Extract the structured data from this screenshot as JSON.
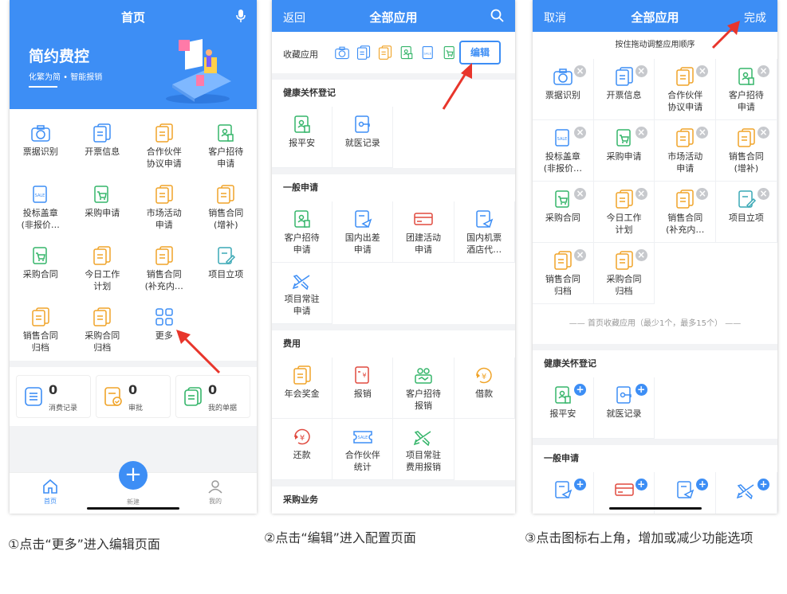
{
  "screen1": {
    "title": "首页",
    "banner_title": "简约费控",
    "banner_subtitle": "化繁为简 • 智能报销",
    "apps": [
      {
        "label": "票据识别",
        "icon": "camera-icon",
        "color": "#3d8ef5"
      },
      {
        "label": "开票信息",
        "icon": "docs-icon",
        "color": "#3d8ef5"
      },
      {
        "label": "合作伙伴\n协议申请",
        "icon": "docs-icon",
        "color": "#f0a429"
      },
      {
        "label": "客户招待\n申请",
        "icon": "user-doc-icon",
        "color": "#35b56a"
      },
      {
        "label": "投标盖章\n(非报价…",
        "icon": "sale-doc-icon",
        "color": "#3d8ef5"
      },
      {
        "label": "采购申请",
        "icon": "cart-doc-icon",
        "color": "#35b56a"
      },
      {
        "label": "市场活动\n申请",
        "icon": "docs-icon",
        "color": "#f0a429"
      },
      {
        "label": "销售合同\n(增补)",
        "icon": "docs-icon",
        "color": "#f0a429"
      },
      {
        "label": "采购合同",
        "icon": "cart-doc-icon",
        "color": "#35b56a"
      },
      {
        "label": "今日工作\n计划",
        "icon": "docs-icon",
        "color": "#f0a429"
      },
      {
        "label": "销售合同\n(补充内…",
        "icon": "docs-icon",
        "color": "#f0a429"
      },
      {
        "label": "项目立项",
        "icon": "edit-doc-icon",
        "color": "#3aa8b5"
      },
      {
        "label": "销售合同\n归档",
        "icon": "docs-icon",
        "color": "#f0a429"
      },
      {
        "label": "采购合同\n归档",
        "icon": "docs-icon",
        "color": "#f0a429"
      },
      {
        "label": "更多",
        "icon": "more-grid-icon",
        "color": "#3d8ef5"
      }
    ],
    "stats": [
      {
        "value": "0",
        "label": "消费记录",
        "icon": "list-icon",
        "color": "#3d8ef5"
      },
      {
        "value": "0",
        "label": "审批",
        "icon": "approve-icon",
        "color": "#f0a429"
      },
      {
        "value": "0",
        "label": "我的单据",
        "icon": "docs-icon",
        "color": "#35b56a"
      }
    ],
    "tabs": {
      "home": "首页",
      "new": "新建",
      "mine": "我的"
    }
  },
  "screen2": {
    "back": "返回",
    "title": "全部应用",
    "favorites_label": "收藏应用",
    "edit": "编辑",
    "sections": [
      {
        "title": "健康关怀登记",
        "apps": [
          {
            "label": "报平安",
            "icon": "user-doc-icon",
            "color": "#35b56a"
          },
          {
            "label": "就医记录",
            "icon": "key-doc-icon",
            "color": "#3d8ef5"
          }
        ]
      },
      {
        "title": "一般申请",
        "apps": [
          {
            "label": "客户招待\n申请",
            "icon": "user-doc-icon",
            "color": "#35b56a"
          },
          {
            "label": "国内出差\n申请",
            "icon": "plane-doc-icon",
            "color": "#3d8ef5"
          },
          {
            "label": "团建活动\n申请",
            "icon": "card-icon",
            "color": "#e04a3f"
          },
          {
            "label": "国内机票\n酒店代…",
            "icon": "plane-doc-icon",
            "color": "#3d8ef5"
          },
          {
            "label": "项目常驻\n申请",
            "icon": "plane-icon",
            "color": "#3d8ef5"
          }
        ]
      },
      {
        "title": "费用",
        "apps": [
          {
            "label": "年会奖金",
            "icon": "docs-icon",
            "color": "#f0a429"
          },
          {
            "label": "报销",
            "icon": "money-doc-icon",
            "color": "#e04a3f"
          },
          {
            "label": "客户招待\n报销",
            "icon": "people-icon",
            "color": "#35b56a"
          },
          {
            "label": "借款",
            "icon": "yen-icon",
            "color": "#f0a429"
          },
          {
            "label": "还款",
            "icon": "yen-icon",
            "color": "#e04a3f"
          },
          {
            "label": "合作伙伴\n统计",
            "icon": "ticket-icon",
            "color": "#3d8ef5"
          },
          {
            "label": "项目常驻\n费用报销",
            "icon": "plane-icon",
            "color": "#35b56a"
          }
        ]
      },
      {
        "title": "采购业务",
        "apps": []
      }
    ]
  },
  "screen3": {
    "cancel": "取消",
    "title": "全部应用",
    "done": "完成",
    "hint": "按住拖动调整应用顺序",
    "favorites": [
      {
        "label": "票据识别",
        "icon": "camera-icon",
        "color": "#3d8ef5"
      },
      {
        "label": "开票信息",
        "icon": "docs-icon",
        "color": "#3d8ef5"
      },
      {
        "label": "合作伙伴\n协议申请",
        "icon": "docs-icon",
        "color": "#f0a429"
      },
      {
        "label": "客户招待\n申请",
        "icon": "user-doc-icon",
        "color": "#35b56a"
      },
      {
        "label": "投标盖章\n(非报价…",
        "icon": "sale-doc-icon",
        "color": "#3d8ef5"
      },
      {
        "label": "采购申请",
        "icon": "cart-doc-icon",
        "color": "#35b56a"
      },
      {
        "label": "市场活动\n申请",
        "icon": "docs-icon",
        "color": "#f0a429"
      },
      {
        "label": "销售合同\n(增补)",
        "icon": "docs-icon",
        "color": "#f0a429"
      },
      {
        "label": "采购合同",
        "icon": "cart-doc-icon",
        "color": "#35b56a"
      },
      {
        "label": "今日工作\n计划",
        "icon": "docs-icon",
        "color": "#f0a429"
      },
      {
        "label": "销售合同\n(补充内…",
        "icon": "docs-icon",
        "color": "#f0a429"
      },
      {
        "label": "项目立项",
        "icon": "edit-doc-icon",
        "color": "#3aa8b5"
      },
      {
        "label": "销售合同\n归档",
        "icon": "docs-icon",
        "color": "#f0a429"
      },
      {
        "label": "采购合同\n归档",
        "icon": "docs-icon",
        "color": "#f0a429"
      }
    ],
    "limit_note": "——  首页收藏应用（最少1个，最多15个）  ——",
    "sections": [
      {
        "title": "健康关怀登记",
        "apps": [
          {
            "label": "报平安",
            "icon": "user-doc-icon",
            "color": "#35b56a"
          },
          {
            "label": "就医记录",
            "icon": "key-doc-icon",
            "color": "#3d8ef5"
          }
        ]
      },
      {
        "title": "一般申请",
        "apps": [
          {
            "label": "",
            "icon": "plane-doc-icon",
            "color": "#3d8ef5"
          },
          {
            "label": "",
            "icon": "card-icon",
            "color": "#e04a3f"
          },
          {
            "label": "",
            "icon": "plane-doc-icon",
            "color": "#3d8ef5"
          },
          {
            "label": "",
            "icon": "plane-icon",
            "color": "#3d8ef5"
          }
        ]
      }
    ]
  },
  "captions": {
    "c1": "①点击“更多”进入编辑页面",
    "c2": "②点击“编辑”进入配置页面",
    "c3": "③点击图标右上角，增加或减少功能选项"
  }
}
